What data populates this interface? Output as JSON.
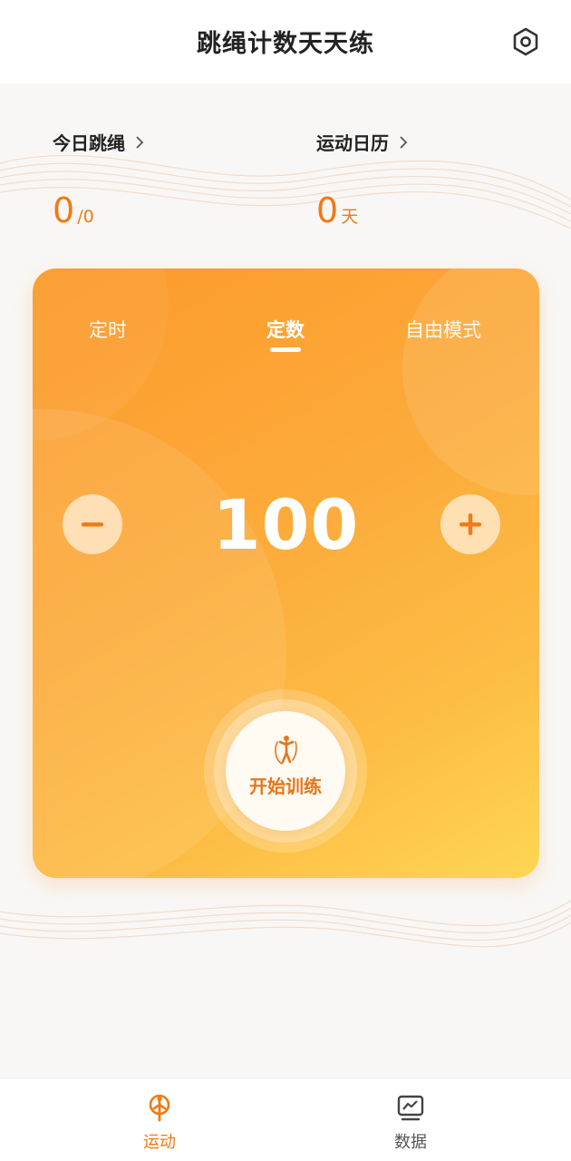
{
  "header": {
    "title": "跳绳计数天天练",
    "settings_icon": "settings-hexagon-icon"
  },
  "stats": {
    "today": {
      "label": "今日跳绳",
      "value": "0",
      "goal": "/0"
    },
    "calendar": {
      "label": "运动日历",
      "value": "0",
      "unit": "天"
    }
  },
  "card": {
    "tabs": [
      {
        "label": "定时",
        "active": false
      },
      {
        "label": "定数",
        "active": true
      },
      {
        "label": "自由模式",
        "active": false
      }
    ],
    "target_value": "100",
    "start_label": "开始训练"
  },
  "tabbar": {
    "items": [
      {
        "label": "运动",
        "icon": "running-person-icon",
        "active": true
      },
      {
        "label": "数据",
        "icon": "chart-monitor-icon",
        "active": false
      }
    ]
  },
  "colors": {
    "accent": "#f07a14",
    "card_gradient_start": "#fb9a2c",
    "card_gradient_end": "#fed653",
    "stepper_icon": "#ef7c1c"
  }
}
